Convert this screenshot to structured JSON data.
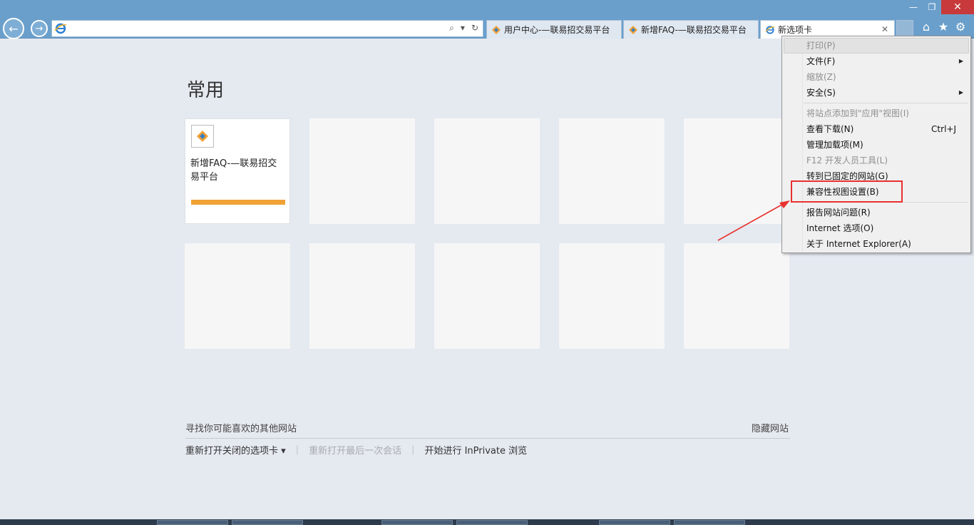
{
  "window": {
    "minimize": "—",
    "restore": "❐",
    "close": "✕"
  },
  "address": {
    "value": "",
    "placeholder": ""
  },
  "tabs": [
    {
      "label": "用户中心-—联易招交易平台"
    },
    {
      "label": "新增FAQ-—联易招交易平台"
    },
    {
      "label": "新选项卡"
    }
  ],
  "page": {
    "heading": "常用",
    "tiles": [
      {
        "title": "新增FAQ-—联易招交易平台"
      }
    ],
    "suggest_text": "寻找你可能喜欢的其他网站",
    "hide_sites": "隐藏网站",
    "links": {
      "reopen_closed": "重新打开关闭的选项卡 ▾",
      "reopen_session": "重新打开最后一次会话",
      "inprivate": "开始进行 InPrivate 浏览"
    }
  },
  "menu": {
    "print": "打印(P)",
    "file": "文件(F)",
    "zoom": "缩放(Z)",
    "safety": "安全(S)",
    "add_to_apps": "将站点添加到\"应用\"视图(I)",
    "downloads": "查看下载(N)",
    "downloads_shortcut": "Ctrl+J",
    "addons": "管理加载项(M)",
    "f12": "F12 开发人员工具(L)",
    "pinned": "转到已固定的网站(G)",
    "compat": "兼容性视图设置(B)",
    "report": "报告网站问题(R)",
    "options": "Internet 选项(O)",
    "about": "关于 Internet Explorer(A)"
  },
  "colors": {
    "titlebar": "#6a9fcb",
    "accent_orange": "#f0a236",
    "annotation_red": "#e8312f"
  }
}
